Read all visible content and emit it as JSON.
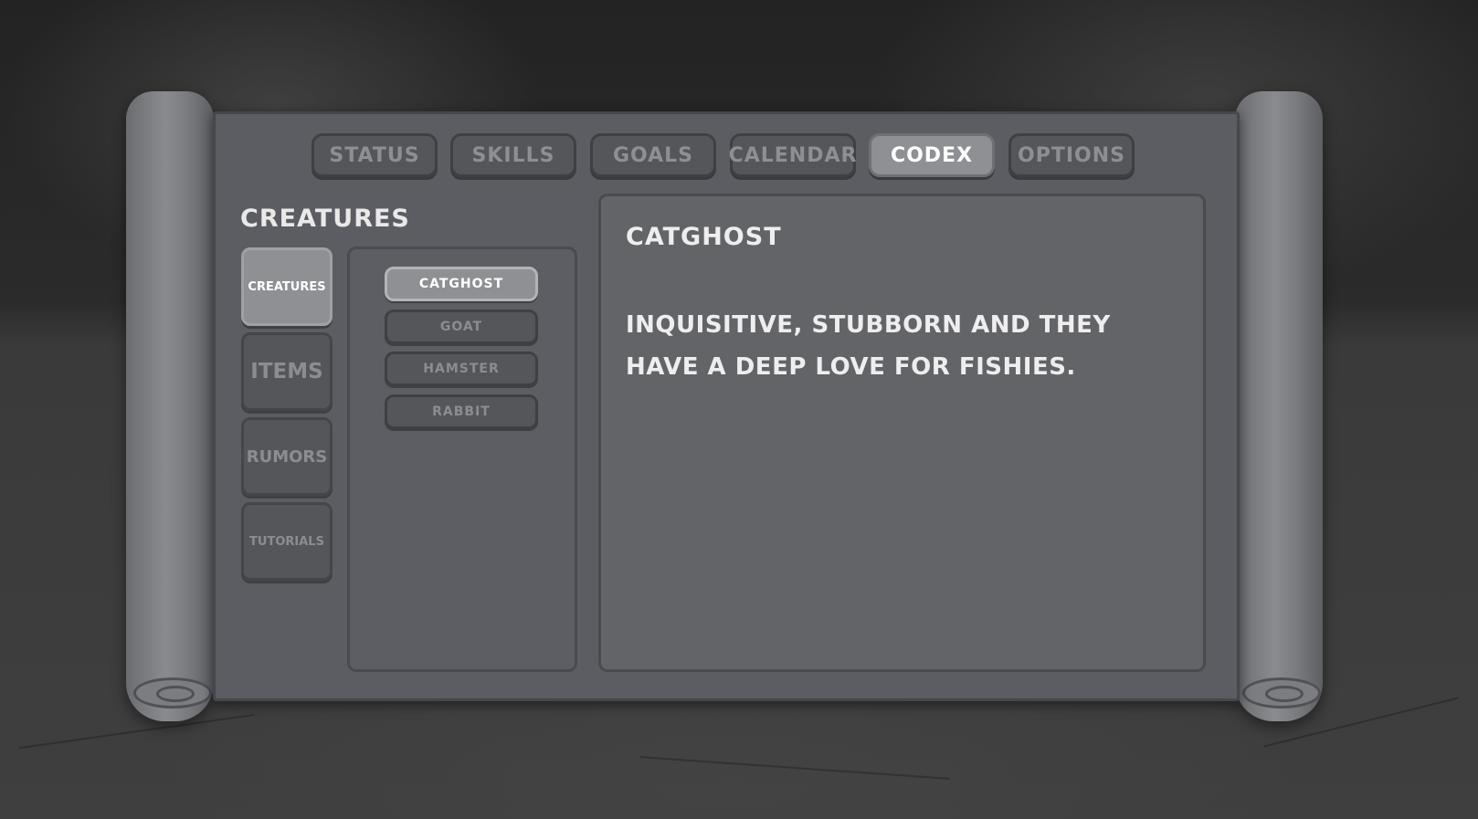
{
  "tabs": [
    {
      "label": "STATUS"
    },
    {
      "label": "SKILLS"
    },
    {
      "label": "GOALS"
    },
    {
      "label": "CALENDAR"
    },
    {
      "label": "CODEX",
      "active": true
    },
    {
      "label": "OPTIONS"
    }
  ],
  "section_title": "CREATURES",
  "categories": [
    {
      "label": "CREATURES",
      "active": true
    },
    {
      "label": "ITEMS"
    },
    {
      "label": "RUMORS"
    },
    {
      "label": "TUTORIALS"
    }
  ],
  "entries": [
    {
      "label": "CATGHOST",
      "active": true
    },
    {
      "label": "GOAT"
    },
    {
      "label": "HAMSTER"
    },
    {
      "label": "RABBIT"
    }
  ],
  "detail": {
    "title": "CATGHOST",
    "description": "INQUISITIVE, STUBBORN AND THEY HAVE A DEEP LOVE FOR FISHIES."
  },
  "colors": {
    "panel": "#5c5d62",
    "active_button": "#8f9094",
    "inactive_button": "#55565a",
    "text_active": "#ffffff",
    "text_inactive": "#8c8d91"
  }
}
